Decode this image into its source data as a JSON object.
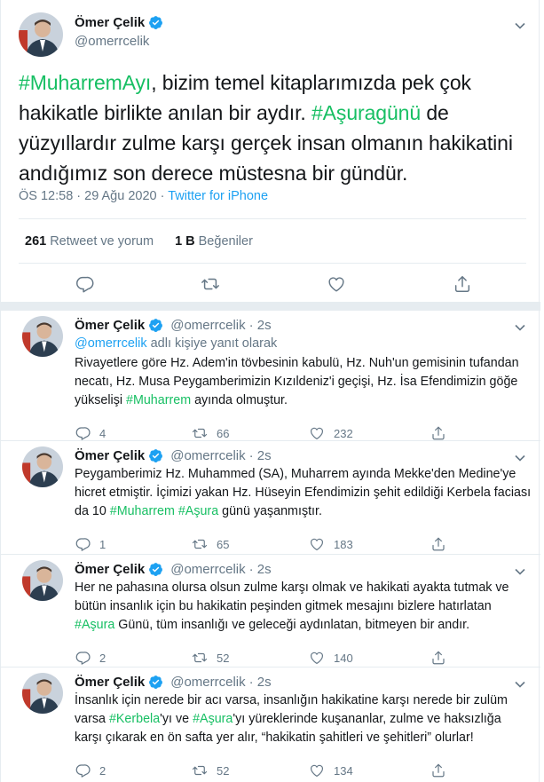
{
  "main_tweet": {
    "name": "Ömer Çelik",
    "handle": "@omerrcelik",
    "text_parts": [
      {
        "t": "#MuharremAyı",
        "h": true
      },
      {
        "t": ", bizim temel kitaplarımızda pek çok hakikatle birlikte anılan bir aydır. ",
        "h": false
      },
      {
        "t": "#Aşuragünü",
        "h": true
      },
      {
        "t": " de yüzyıllardır zulme karşı gerçek insan olmanın hakikatini andığımız son derece müstesna bir gündür.",
        "h": false
      }
    ],
    "timestamp": "ÖS 12:58 · 29 Ağu 2020 · ",
    "source": "Twitter for iPhone",
    "retweets_count": "261",
    "retweets_label": "Retweet ve yorum",
    "likes_count": "1 B",
    "likes_label": "Beğeniler"
  },
  "replies": [
    {
      "name": "Ömer Çelik",
      "handle": "@omerrcelik",
      "time": "· 2s",
      "reply_to_handle": "@omerrcelik",
      "reply_to_label": " adlı kişiye yanıt olarak",
      "text_parts": [
        {
          "t": "Rivayetlere göre Hz. Adem'in tövbesinin kabulü, Hz. Nuh'un gemisinin tufandan necatı, Hz. Musa Peygamberimizin Kızıldeniz'i geçişi, Hz. İsa Efendimizin göğe yükselişi ",
          "h": false
        },
        {
          "t": "#Muharrem",
          "h": true
        },
        {
          "t": " ayında olmuştur.",
          "h": false
        }
      ],
      "replies": "4",
      "retweets": "66",
      "likes": "232"
    },
    {
      "name": "Ömer Çelik",
      "handle": "@omerrcelik",
      "time": "· 2s",
      "text_parts": [
        {
          "t": "Peygamberimiz Hz. Muhammed (SA), Muharrem ayında Mekke'den Medine'ye hicret etmiştir. İçimizi yakan Hz. Hüseyin Efendimizin şehit edildiği Kerbela faciası da 10 ",
          "h": false
        },
        {
          "t": "#Muharrem",
          "h": true
        },
        {
          "t": " ",
          "h": false
        },
        {
          "t": "#Aşura",
          "h": true
        },
        {
          "t": " günü yaşanmıştır.",
          "h": false
        }
      ],
      "replies": "1",
      "retweets": "65",
      "likes": "183"
    },
    {
      "name": "Ömer Çelik",
      "handle": "@omerrcelik",
      "time": "· 2s",
      "text_parts": [
        {
          "t": "Her ne pahasına olursa olsun zulme karşı olmak ve hakikati ayakta tutmak ve bütün insanlık için bu hakikatin peşinden gitmek mesajını bizlere hatırlatan ",
          "h": false
        },
        {
          "t": "#Aşura",
          "h": true
        },
        {
          "t": " Günü, tüm insanlığı ve geleceği aydınlatan, bitmeyen bir andır.",
          "h": false
        }
      ],
      "replies": "2",
      "retweets": "52",
      "likes": "140"
    },
    {
      "name": "Ömer Çelik",
      "handle": "@omerrcelik",
      "time": "· 2s",
      "text_parts": [
        {
          "t": "İnsanlık için nerede bir acı varsa, insanlığın hakikatine karşı nerede bir zulüm varsa ",
          "h": false
        },
        {
          "t": "#Kerbela",
          "h": true
        },
        {
          "t": "'yı ve ",
          "h": false
        },
        {
          "t": "#Aşura",
          "h": true
        },
        {
          "t": "'yı yüreklerinde kuşananlar, zulme ve haksızlığa karşı çıkarak en ön safta yer alır, “hakikatin şahitleri ve şehitleri” olurlar!",
          "h": false
        }
      ],
      "replies": "2",
      "retweets": "52",
      "likes": "134"
    }
  ],
  "colors": {
    "hashtag": "#17bf63",
    "link": "#1da1f2",
    "secondary_text": "#657786",
    "divider": "#e6ecf0",
    "verified": "#1da1f2"
  },
  "icons": [
    "verified-badge-icon",
    "chevron-down-icon",
    "reply-icon",
    "retweet-icon",
    "like-icon",
    "share-icon",
    "avatar-photo"
  ]
}
